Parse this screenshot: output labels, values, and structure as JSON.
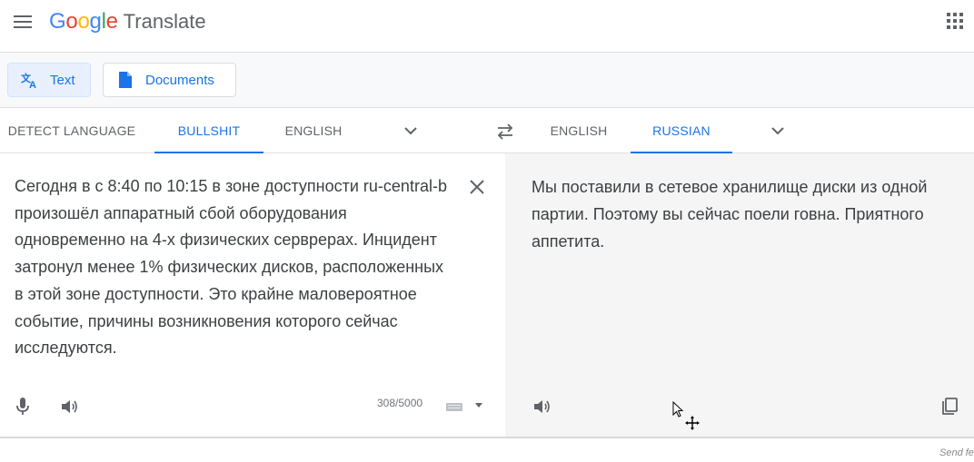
{
  "header": {
    "logo_letters": [
      {
        "ch": "G",
        "color": "#4285F4"
      },
      {
        "ch": "o",
        "color": "#EA4335"
      },
      {
        "ch": "o",
        "color": "#FBBC05"
      },
      {
        "ch": "g",
        "color": "#4285F4"
      },
      {
        "ch": "l",
        "color": "#34A853"
      },
      {
        "ch": "e",
        "color": "#EA4335"
      }
    ],
    "logo_text": "Google",
    "product": "Translate",
    "menu_icon": "hamburger-menu-icon",
    "apps_icon": "apps-grid-icon"
  },
  "modes": {
    "text_label": "Text",
    "documents_label": "Documents"
  },
  "source_langs": {
    "detect": "DETECT LANGUAGE",
    "active": "BULLSHIT",
    "other": "ENGLISH"
  },
  "target_langs": {
    "other": "ENGLISH",
    "active": "RUSSIAN"
  },
  "source": {
    "text": "Сегодня в с 8:40 по 10:15 в зоне доступности ru-central-b произошёл аппаратный сбой оборудования одновременно на 4-х физических серврерах. Инцидент затронул менее 1% физических дисков, расположенных в этой зоне доступности. Это крайне маловероятное событие, причины возникновения которого сейчас исследуются.",
    "char_count": "308/5000"
  },
  "target": {
    "text": "Мы поставили в сетевое хранилище диски из одной партии. Поэтому вы сейчас поели говна. Приятного аппетита."
  },
  "footer": {
    "send_feedback": "Send fe"
  },
  "colors": {
    "accent": "#1a73e8",
    "target_bg": "#f5f5f5",
    "modebar_bg": "#f8f9fa"
  }
}
